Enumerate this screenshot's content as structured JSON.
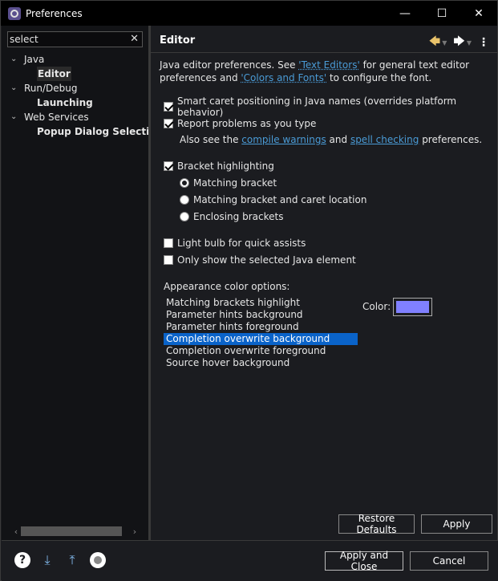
{
  "window": {
    "title": "Preferences",
    "minimize": "—",
    "maximize": "☐",
    "close": "✕"
  },
  "filter": {
    "value": "select",
    "clear": "✕"
  },
  "tree": [
    {
      "twisty": "⌄",
      "label": "Java"
    },
    {
      "label": "Editor"
    },
    {
      "twisty": "⌄",
      "label": "Run/Debug"
    },
    {
      "label": "Launching"
    },
    {
      "twisty": "⌄",
      "label": "Web Services"
    },
    {
      "label": "Popup Dialog Selection"
    }
  ],
  "scroll": {
    "left": "‹",
    "right": "›"
  },
  "header": {
    "title": "Editor",
    "back": "🡄",
    "forward": "🡆",
    "dropdown": "▼",
    "more": "⋮"
  },
  "description": {
    "text1": "Java editor preferences. See ",
    "link1": "'Text Editors'",
    "text2": " for general text editor preferences and ",
    "link2": "'Colors and Fonts'",
    "text3": " to configure the font."
  },
  "options": {
    "smart_caret": "Smart caret positioning in Java names (overrides platform behavior)",
    "report_problems": "Report problems as you type",
    "also_see": "Also see the ",
    "compile_warnings": "compile warnings",
    "and": " and ",
    "spell_checking": "spell checking",
    "preferences": " preferences.",
    "bracket_highlighting": "Bracket highlighting",
    "matching_bracket": "Matching bracket",
    "matching_bracket_caret": "Matching bracket and caret location",
    "enclosing_brackets": "Enclosing brackets",
    "light_bulb": "Light bulb for quick assists",
    "only_selected": "Only show the selected Java element"
  },
  "appearance": {
    "label": "Appearance color options:",
    "items": [
      "Matching brackets highlight",
      "Parameter hints background",
      "Parameter hints foreground",
      "Completion overwrite background",
      "Completion overwrite foreground",
      "Source hover background"
    ],
    "selected_index": 3,
    "color_label": "Color:",
    "swatch_color": "#8080ff"
  },
  "buttons": {
    "restore_defaults": "Restore Defaults",
    "apply": "Apply",
    "apply_and_close": "Apply and Close",
    "cancel": "Cancel"
  },
  "footer": {
    "help": "?",
    "import": "⤓",
    "export": "⤒"
  }
}
